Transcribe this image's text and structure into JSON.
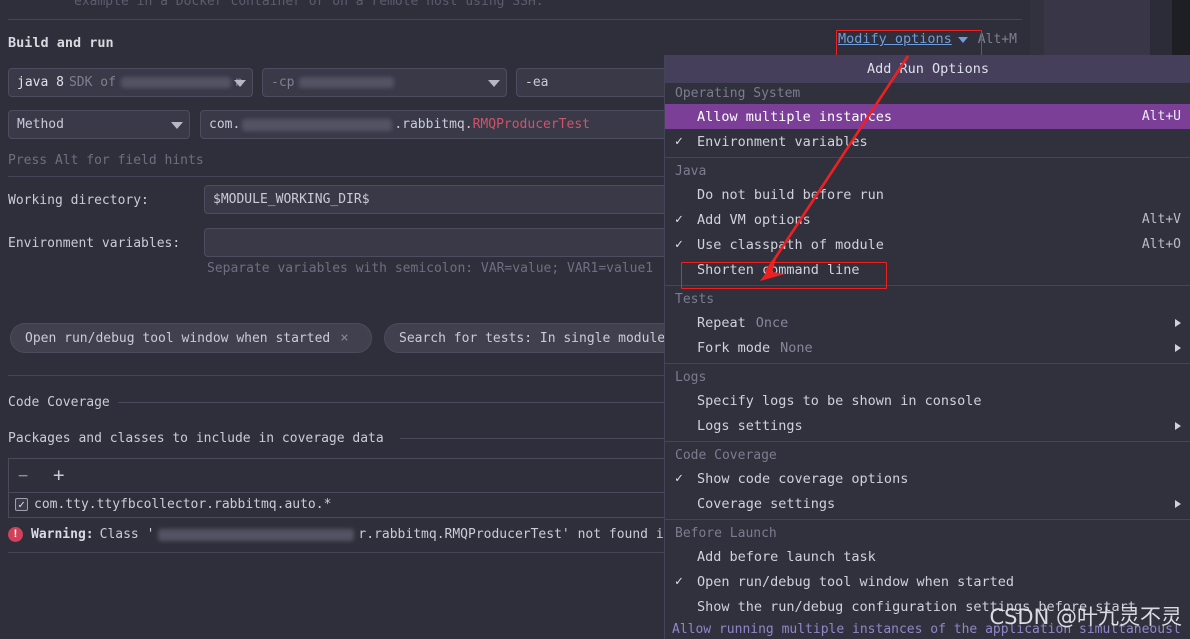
{
  "window": {
    "cut_off_top_text": "example in a Docker container or on a remote host using SSH."
  },
  "build_and_run": {
    "section_title": "Build and run",
    "jre_field": {
      "value_strong": "java 8",
      "value_dim": "SDK of",
      "value_tail": "n",
      "icon": "chevron-down-icon"
    },
    "cp_field": {
      "value": "-cp",
      "icon": "chevron-down-icon"
    },
    "vm_field": {
      "value": "-ea"
    },
    "kind_field": {
      "value": "Method",
      "icon": "chevron-down-icon"
    },
    "class_field": {
      "prefix": "com.",
      "suffix": ".rabbitmq.",
      "highlight": "RMQProducerTest"
    },
    "alt_hint": "Press Alt for field hints"
  },
  "form": {
    "working_directory_label": "Working directory:",
    "working_directory_value": "$MODULE_WORKING_DIR$",
    "environment_variables_label": "Environment variables:",
    "environment_variables_value": "",
    "environment_variables_hint": "Separate variables with semicolon: VAR=value; VAR1=value1"
  },
  "chips": [
    {
      "label": "Open run/debug tool window when started",
      "close": "×"
    },
    {
      "label": "Search for tests: In single module"
    }
  ],
  "code_coverage": {
    "section_title": "Code Coverage",
    "group_title": "Packages and classes to include in coverage data",
    "toolbar": {
      "remove": "−",
      "add": "+"
    },
    "rows": [
      {
        "checked": "✓",
        "label": "com.tty.ttyfbcollector.rabbitmq.auto.*"
      }
    ]
  },
  "warning": {
    "icon": "error-icon",
    "icon_glyph": "!",
    "prefix": "Warning:",
    "text_before": "Class '",
    "text_after": "r.rabbitmq.RMQProducerTest' not found in m"
  },
  "modify_options": {
    "label": "Modify options",
    "icon": "chevron-down-icon",
    "shortcut": "Alt+M"
  },
  "menu": {
    "header": "Add Run Options",
    "groups": [
      {
        "title": "Operating System",
        "items": [
          {
            "check": "",
            "label": "Allow multiple instances",
            "accel": "Alt+U",
            "selected": true,
            "submenu": false
          },
          {
            "check": "✓",
            "label": "Environment variables",
            "accel": "",
            "selected": false,
            "submenu": false
          }
        ]
      },
      {
        "title": "Java",
        "items": [
          {
            "check": "",
            "label": "Do not build before run",
            "accel": "",
            "selected": false,
            "submenu": false
          },
          {
            "check": "✓",
            "label": "Add VM options",
            "accel": "Alt+V",
            "selected": false,
            "submenu": false
          },
          {
            "check": "✓",
            "label": "Use classpath of module",
            "accel": "Alt+O",
            "selected": false,
            "submenu": false
          },
          {
            "check": "",
            "label": "Shorten command line",
            "accel": "",
            "selected": false,
            "submenu": false,
            "annotated": true
          }
        ]
      },
      {
        "title": "Tests",
        "items": [
          {
            "check": "",
            "label": "Repeat",
            "value": "Once",
            "accel": "",
            "selected": false,
            "submenu": true
          },
          {
            "check": "",
            "label": "Fork mode",
            "value": "None",
            "accel": "",
            "selected": false,
            "submenu": true
          }
        ]
      },
      {
        "title": "Logs",
        "items": [
          {
            "check": "",
            "label": "Specify logs to be shown in console",
            "accel": "",
            "selected": false,
            "submenu": false
          },
          {
            "check": "",
            "label": "Logs settings",
            "accel": "",
            "selected": false,
            "submenu": true
          }
        ]
      },
      {
        "title": "Code Coverage",
        "items": [
          {
            "check": "✓",
            "label": "Show code coverage options",
            "accel": "",
            "selected": false,
            "submenu": false
          },
          {
            "check": "",
            "label": "Coverage settings",
            "accel": "",
            "selected": false,
            "submenu": true
          }
        ]
      },
      {
        "title": "Before Launch",
        "items": [
          {
            "check": "",
            "label": "Add before launch task",
            "accel": "",
            "selected": false,
            "submenu": false
          },
          {
            "check": "✓",
            "label": "Open run/debug tool window when started",
            "accel": "",
            "selected": false,
            "submenu": false
          },
          {
            "check": "",
            "label": "Show the run/debug configuration settings before start",
            "accel": "",
            "selected": false,
            "submenu": false
          }
        ]
      }
    ],
    "footer_hint": "Allow running multiple instances of the application simultaneousl"
  },
  "watermark": "CSDN @叶九灵不灵",
  "colors": {
    "background": "#2f2f3b",
    "menu_background": "#31313d",
    "menu_header": "#453f5c",
    "selection": "#7b3f98",
    "link": "#6f9ddb",
    "annotation": "#f02020",
    "error": "#d2405a",
    "class_highlight": "#d0536b",
    "footer_hint": "#8f86c9"
  }
}
